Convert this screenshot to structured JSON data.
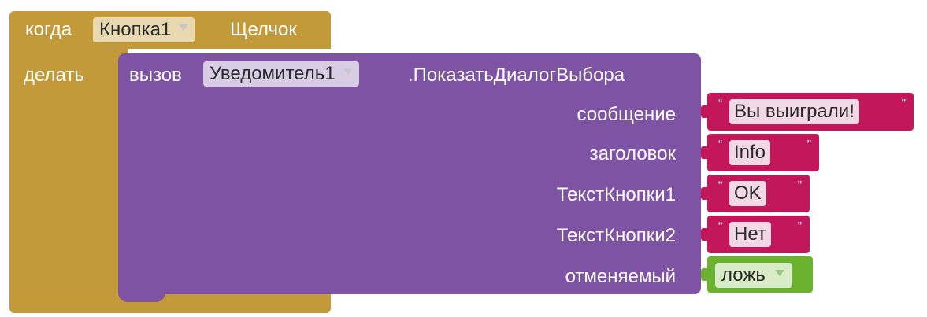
{
  "colors": {
    "event_block": "#c29a3a",
    "event_dropdown_bg": "#e9d9b1",
    "call_block": "#7f53a3",
    "call_dropdown_bg": "#d8cde5",
    "text_block": "#c2185b",
    "logic_block": "#6bb22f"
  },
  "event": {
    "when_label": "когда",
    "component": "Кнопка1",
    "event_name": "Щелчок",
    "do_label": "делать"
  },
  "call": {
    "call_label": "вызов",
    "component": "Уведомитель1",
    "method": ".ПоказатьДиалогВыбора",
    "params": [
      {
        "name": "сообщение",
        "value": "Вы выиграли!"
      },
      {
        "name": "заголовок",
        "value": "Info"
      },
      {
        "name": "ТекстКнопки1",
        "value": "OK"
      },
      {
        "name": "ТекстКнопки2",
        "value": "Нет"
      },
      {
        "name": "отменяемый",
        "value": "ложь"
      }
    ]
  },
  "icons": {
    "dropdown": "chevron-down-icon",
    "quote": "quote-icon"
  }
}
